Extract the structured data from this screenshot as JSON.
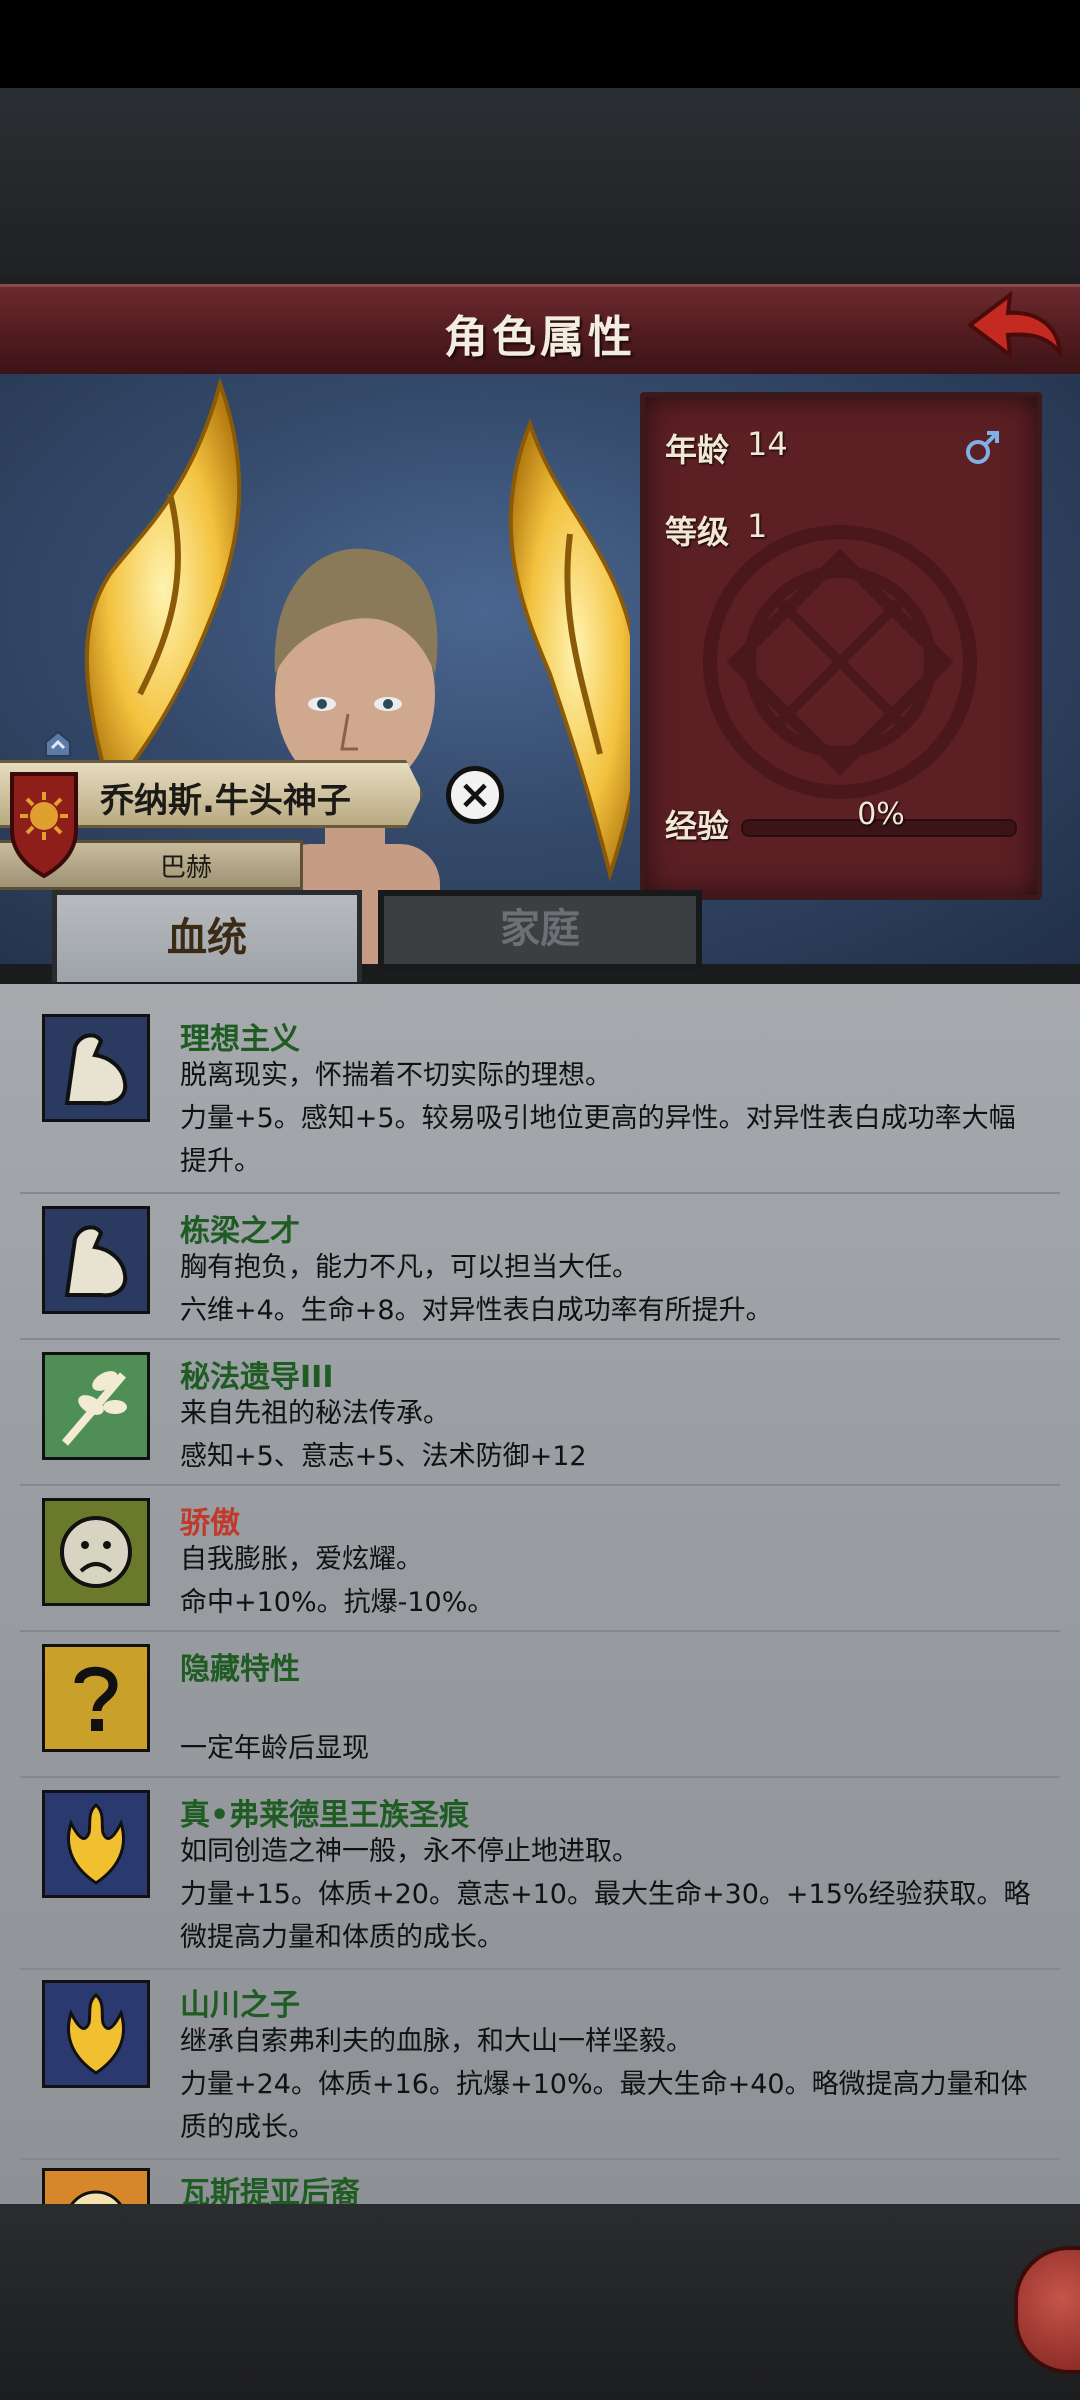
{
  "header": {
    "title": "角色属性",
    "back_icon": "red-curved-back-arrow-icon"
  },
  "character": {
    "name": "乔纳斯.牛头神子",
    "title": "巴赫",
    "age_label": "年龄",
    "age": "14",
    "gender_icon": "male-symbol-icon",
    "level_label": "等级",
    "level": "1",
    "exp_label": "经验",
    "exp_pct": "0%",
    "exp_fraction": 0
  },
  "tabs": [
    {
      "label": "血统",
      "active": true
    },
    {
      "label": "家庭",
      "active": false
    }
  ],
  "traits": [
    {
      "name": "理想主义",
      "icon": "flexed-arm-icon",
      "lines": [
        "脱离现实，怀揣着不切实际的理想。",
        "力量+5。感知+5。较易吸引地位更高的异性。对异性表白成功率大幅",
        "提升。"
      ],
      "negative": false
    },
    {
      "name": "栋梁之才",
      "icon": "flexed-arm-icon",
      "lines": [
        "胸有抱负，能力不凡，可以担当大任。",
        "六维+4。生命+8。对异性表白成功率有所提升。"
      ],
      "negative": false
    },
    {
      "name": "秘法遗导III",
      "icon": "sprouting-branch-icon",
      "lines": [
        "来自先祖的秘法传承。",
        "感知+5、意志+5、法术防御+12"
      ],
      "negative": false
    },
    {
      "name": "骄傲",
      "icon": "sad-face-icon",
      "lines": [
        "自我膨胀，爱炫耀。",
        "命中+10%。抗爆-10%。"
      ],
      "negative": true
    },
    {
      "name": "隐藏特性",
      "icon": "question-mark-icon",
      "lines": [
        "",
        "一定年龄后显现"
      ],
      "negative": false
    },
    {
      "name": "真•弗莱德里王族圣痕",
      "icon": "golden-flame-crest-icon",
      "lines": [
        "如同创造之神一般，永不停止地进取。",
        "力量+15。体质+20。意志+10。最大生命+30。+15%经验获取。略",
        "微提高力量和体质的成长。"
      ],
      "negative": false
    },
    {
      "name": "山川之子",
      "icon": "golden-flame-crest-icon",
      "lines": [
        "继承自索弗利夫的血脉，和大山一样坚毅。",
        "力量+24。体质+16。抗爆+10%。最大生命+40。略微提高力量和体",
        "质的成长。"
      ],
      "negative": false
    },
    {
      "name": "瓦斯提亚后裔",
      "icon": "sun-face-icon",
      "lines": [],
      "negative": false
    }
  ],
  "colors": {
    "trait_name_positive": "#1f5c24",
    "trait_name_negative": "#c0392b",
    "title_ribbon": "#5b1f24"
  }
}
